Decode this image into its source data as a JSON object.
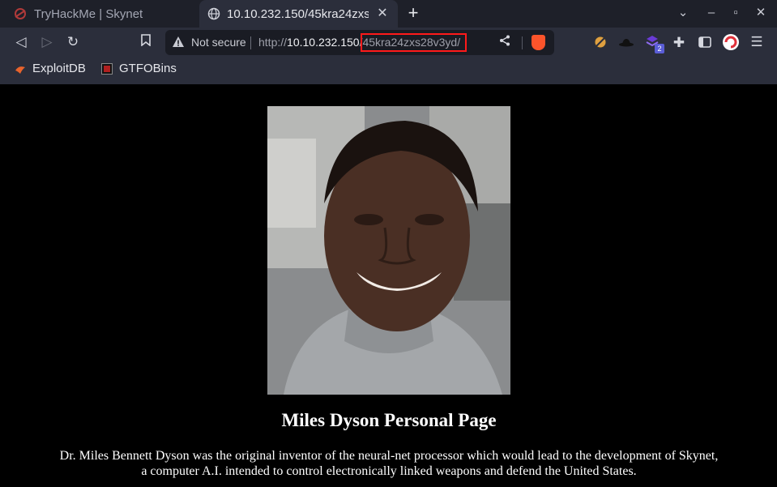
{
  "tabs": [
    {
      "title": "TryHackMe | Skynet",
      "active": false
    },
    {
      "title": "10.10.232.150/45kra24zxs28v3yd/",
      "active": true
    }
  ],
  "toolbar": {
    "security_label": "Not secure",
    "url_protocol": "http://",
    "url_host": "10.10.232.150",
    "url_path": "/45kra24zxs28v3yd/",
    "extension_badge": "2"
  },
  "bookmarks": [
    {
      "label": "ExploitDB"
    },
    {
      "label": "GTFOBins"
    }
  ],
  "page": {
    "heading": "Miles Dyson Personal Page",
    "bio_line1": "Dr. Miles Bennett Dyson was the original inventor of the neural-net processor which would lead to the development of Skynet,",
    "bio_line2": "a computer A.I. intended to control electronically linked weapons and defend the United States."
  },
  "colors": {
    "highlight": "#ff1a1a",
    "brave": "#fb542b",
    "tab_strip": "#1e2029",
    "toolbar": "#2b2e3b"
  }
}
